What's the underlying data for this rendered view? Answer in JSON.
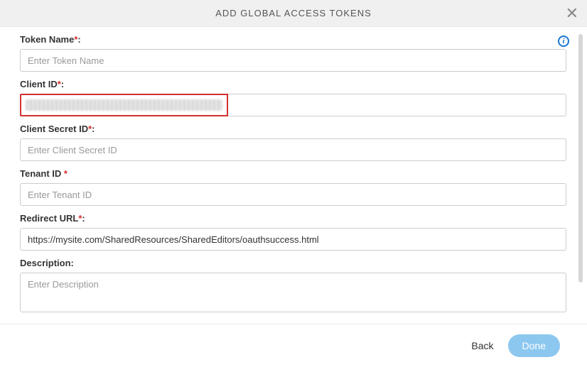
{
  "header": {
    "title": "ADD GLOBAL ACCESS TOKENS"
  },
  "form": {
    "tokenName": {
      "label": "Token Name",
      "required": "*",
      "placeholder": "Enter Token Name",
      "value": ""
    },
    "clientId": {
      "label": "Client ID",
      "required": "*",
      "value": ""
    },
    "clientSecretId": {
      "label": "Client Secret ID",
      "required": "*",
      "placeholder": "Enter Client Secret ID",
      "value": ""
    },
    "tenantId": {
      "label": "Tenant ID ",
      "required": "*",
      "placeholder": "Enter Tenant ID",
      "value": ""
    },
    "redirectUrl": {
      "label": "Redirect URL",
      "required": "*",
      "value": "https://mysite.com/SharedResources/SharedEditors/oauthsuccess.html"
    },
    "description": {
      "label": "Description:",
      "placeholder": "Enter Description",
      "value": ""
    }
  },
  "footer": {
    "back": "Back",
    "done": "Done"
  }
}
